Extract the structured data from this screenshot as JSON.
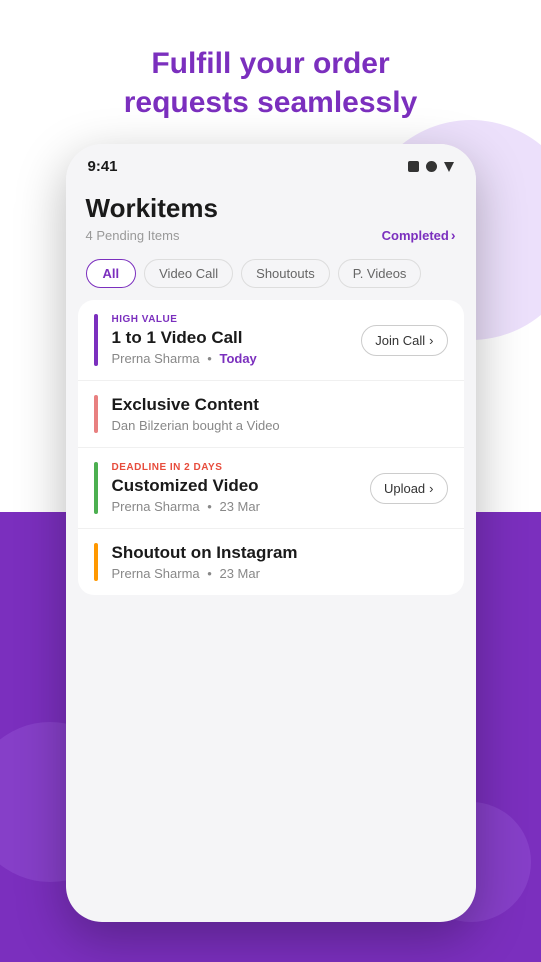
{
  "hero": {
    "title_line1": "Fulfill your order",
    "title_line2": "requests seamlessly",
    "title_full": "Fulfill your order requests seamlessly"
  },
  "statusBar": {
    "time": "9:41"
  },
  "page": {
    "title": "Workitems",
    "pending": "4 Pending Items",
    "completed": "Completed",
    "chevron": "›"
  },
  "filters": [
    {
      "label": "All",
      "active": true
    },
    {
      "label": "Video Call",
      "active": false
    },
    {
      "label": "Shoutouts",
      "active": false
    },
    {
      "label": "P. Videos",
      "active": false
    }
  ],
  "workItems": [
    {
      "id": 1,
      "badge": "HIGH VALUE",
      "badgeType": "high-value",
      "title": "1 to 1 Video Call",
      "meta1": "Prerna Sharma",
      "dot": "•",
      "meta2": "Today",
      "meta2Highlight": true,
      "accentColor": "#7B2FBE",
      "action": "Join Call",
      "actionChevron": "›",
      "hasAction": true
    },
    {
      "id": 2,
      "badge": "",
      "badgeType": "",
      "title": "Exclusive Content",
      "meta1": "Dan Bilzerian bought a Video",
      "dot": "",
      "meta2": "",
      "meta2Highlight": false,
      "accentColor": "#e88080",
      "action": "",
      "hasAction": false
    },
    {
      "id": 3,
      "badge": "DEADLINE IN 2 DAYS",
      "badgeType": "deadline",
      "title": "Customized Video",
      "meta1": "Prerna Sharma",
      "dot": "•",
      "meta2": "23 Mar",
      "meta2Highlight": false,
      "accentColor": "#4CAF50",
      "action": "Upload",
      "actionChevron": "›",
      "hasAction": true
    },
    {
      "id": 4,
      "badge": "",
      "badgeType": "",
      "title": "Shoutout on Instagram",
      "meta1": "Prerna Sharma",
      "dot": "•",
      "meta2": "23 Mar",
      "meta2Highlight": false,
      "accentColor": "#FF9800",
      "action": "",
      "hasAction": false
    }
  ]
}
